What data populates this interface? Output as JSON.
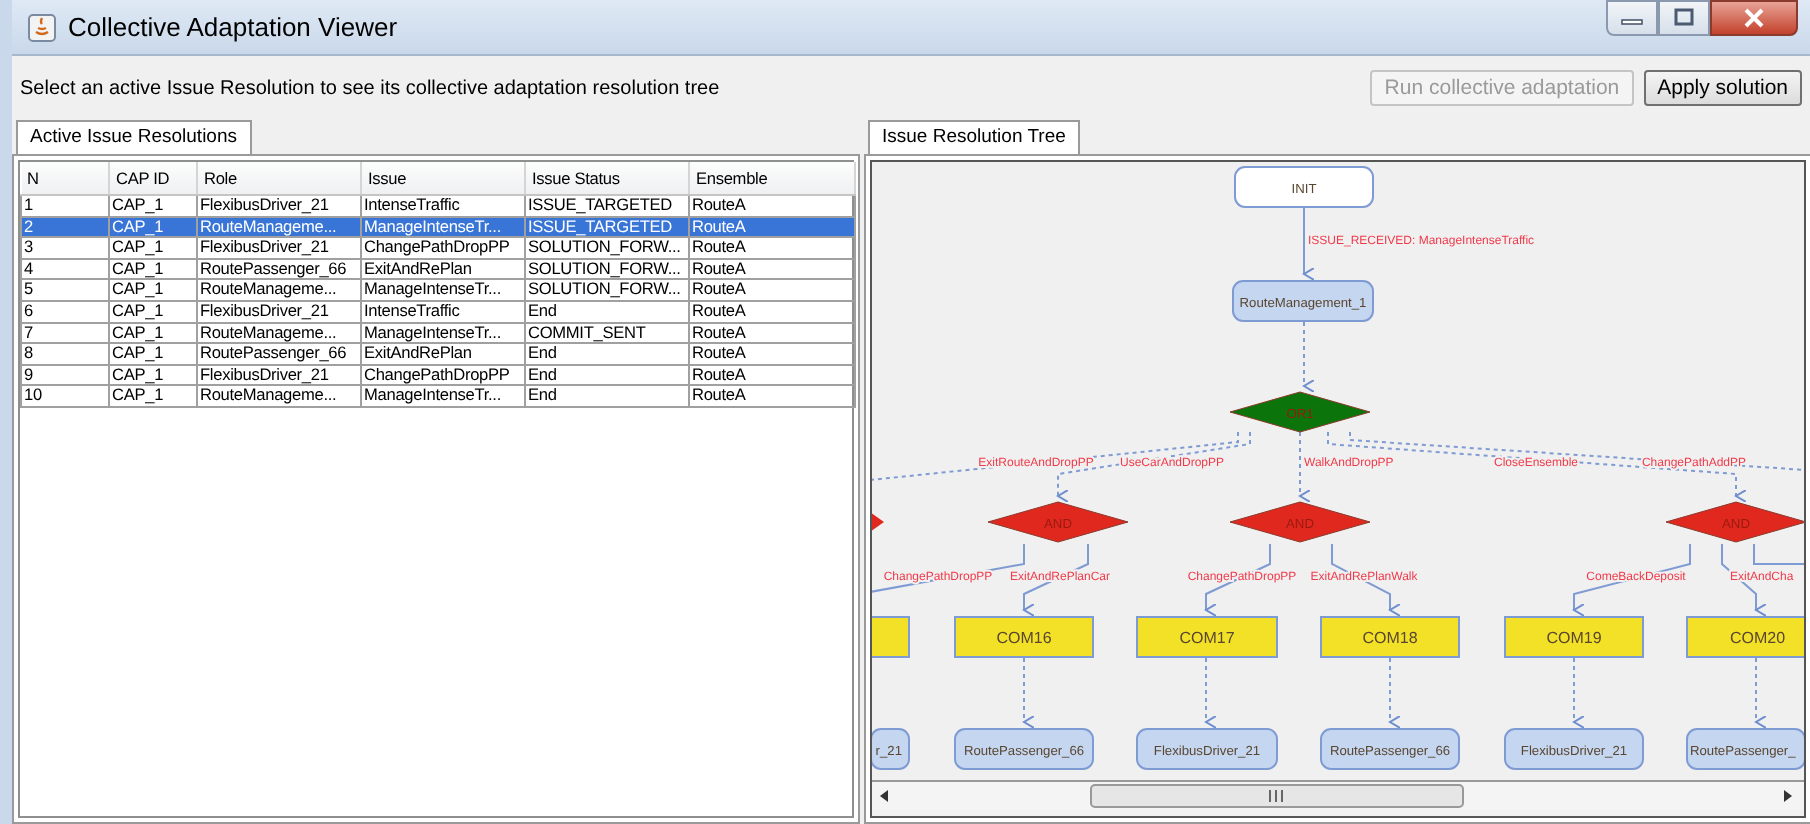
{
  "window": {
    "title": "Collective Adaptation Viewer"
  },
  "instruction": "Select an active Issue Resolution to see its collective adaptation resolution tree",
  "buttons": [
    {
      "label": "Run collective adaptation",
      "disabled": true
    },
    {
      "label": "Apply solution",
      "disabled": false
    }
  ],
  "left_tab": {
    "label": "Active Issue Resolutions",
    "selected": true
  },
  "table": {
    "columns": [
      "N",
      "CAP ID",
      "Role",
      "Issue",
      "Issue Status",
      "Ensemble"
    ],
    "rows": [
      {
        "cells": [
          "1",
          "CAP_1",
          "FlexibusDriver_21",
          "IntenseTraffic",
          "ISSUE_TARGETED",
          "RouteA"
        ],
        "selected": false
      },
      {
        "cells": [
          "2",
          "CAP_1",
          "RouteManageme...",
          "ManageIntenseTr...",
          "ISSUE_TARGETED",
          "RouteA"
        ],
        "selected": true
      },
      {
        "cells": [
          "3",
          "CAP_1",
          "FlexibusDriver_21",
          "ChangePathDropPP",
          "SOLUTION_FORW...",
          "RouteA"
        ],
        "selected": false
      },
      {
        "cells": [
          "4",
          "CAP_1",
          "RoutePassenger_66",
          "ExitAndRePlan",
          "SOLUTION_FORW...",
          "RouteA"
        ],
        "selected": false
      },
      {
        "cells": [
          "5",
          "CAP_1",
          "RouteManageme...",
          "ManageIntenseTr...",
          "SOLUTION_FORW...",
          "RouteA"
        ],
        "selected": false
      },
      {
        "cells": [
          "6",
          "CAP_1",
          "FlexibusDriver_21",
          "IntenseTraffic",
          "End",
          "RouteA"
        ],
        "selected": false
      },
      {
        "cells": [
          "7",
          "CAP_1",
          "RouteManageme...",
          "ManageIntenseTr...",
          "COMMIT_SENT",
          "RouteA"
        ],
        "selected": false
      },
      {
        "cells": [
          "8",
          "CAP_1",
          "RoutePassenger_66",
          "ExitAndRePlan",
          "End",
          "RouteA"
        ],
        "selected": false
      },
      {
        "cells": [
          "9",
          "CAP_1",
          "FlexibusDriver_21",
          "ChangePathDropPP",
          "End",
          "RouteA"
        ],
        "selected": false
      },
      {
        "cells": [
          "10",
          "CAP_1",
          "RouteManageme...",
          "ManageIntenseTr...",
          "End",
          "RouteA"
        ],
        "selected": false
      }
    ]
  },
  "right_tab": {
    "label": "Issue Resolution Tree",
    "selected": true
  },
  "tree": {
    "nodes": [
      {
        "kind": "start",
        "text": "INIT"
      },
      {
        "kind": "role",
        "text": "RouteManagement_1"
      },
      {
        "kind": "or",
        "text": "OR1"
      },
      {
        "kind": "and"
      },
      {
        "kind": "and",
        "text": "AND"
      },
      {
        "kind": "and",
        "text": "AND"
      },
      {
        "kind": "and",
        "text": "AND"
      },
      {
        "kind": "com"
      },
      {
        "kind": "com",
        "text": "COM16"
      },
      {
        "kind": "com",
        "text": "COM17"
      },
      {
        "kind": "com",
        "text": "COM18"
      },
      {
        "kind": "com",
        "text": "COM19"
      },
      {
        "kind": "com",
        "text": "COM20"
      },
      {
        "kind": "role",
        "text": "r_21"
      },
      {
        "kind": "role",
        "text": "RoutePassenger_66"
      },
      {
        "kind": "role",
        "text": "FlexibusDriver_21"
      },
      {
        "kind": "role",
        "text": "RoutePassenger_66"
      },
      {
        "kind": "role",
        "text": "FlexibusDriver_21"
      },
      {
        "kind": "role",
        "text": "RoutePassenger_"
      }
    ],
    "edge_labels": [
      "ISSUE_RECEIVED: ManageIntenseTraffic",
      "ExitRouteAndDropPP",
      "UseCarAndDropPP",
      "WalkAndDropPP",
      "CloseEnsemble",
      "ChangePathAddPP",
      "ChangePathDropPP",
      "ExitAndRePlanCar",
      "ChangePathDropPP",
      "ExitAndRePlanWalk",
      "ComeBackDeposit",
      "ExitAndCha"
    ]
  }
}
